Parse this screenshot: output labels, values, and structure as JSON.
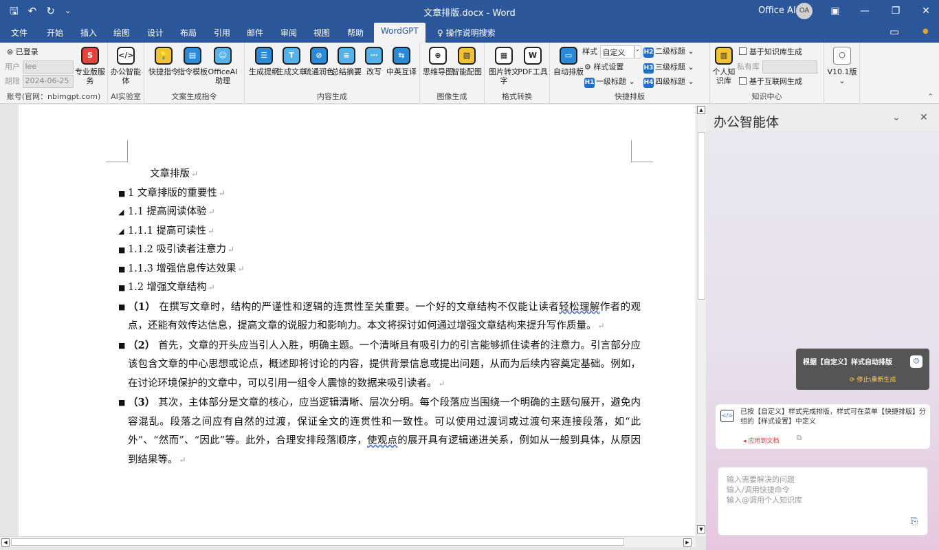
{
  "titlebar": {
    "qat": {
      "save_icon": "save-icon",
      "undo_icon": "undo-icon",
      "redo_icon": "redo-icon",
      "customize": "customize-icon"
    },
    "title": "文章排版.docx  -  Word",
    "account": "Office AI",
    "avatar": "OA",
    "window_buttons": {
      "ribbon_display": "▣",
      "minimize": "—",
      "restore": "❐",
      "close": "✕"
    }
  },
  "menubar": {
    "tabs": [
      "文件",
      "开始",
      "插入",
      "绘图",
      "设计",
      "布局",
      "引用",
      "邮件",
      "审阅",
      "视图",
      "帮助",
      "WordGPT"
    ],
    "active_tab": "WordGPT",
    "search": "操作说明搜索",
    "comments_icon": "comment-icon"
  },
  "ribbon": {
    "account": {
      "logged_in": "已登录",
      "user_label": "用户",
      "user_value": "lee",
      "expire_label": "期限",
      "expire_value": "2024-06-25",
      "pro_label": "专业版服务",
      "group": "账号(官网：nbimgpt.com)"
    },
    "lab": {
      "agent": "办公智能体",
      "group": "AI实验室"
    },
    "copy": {
      "quick": "快捷指令",
      "template": "指令模板",
      "assistant": "OfficeAI助理",
      "group": "文案生成指令"
    },
    "content": {
      "outline": "生成提纲",
      "article": "生成文章",
      "polish": "疏通润色",
      "summary": "总结摘要",
      "rewrite": "改写",
      "translate": "中英互译",
      "group": "内容生成"
    },
    "image": {
      "mindmap": "思维导图",
      "smartimg": "智能配图",
      "group": "图像生成"
    },
    "format": {
      "img2text": "图片转文字",
      "pdf": "PDF工具",
      "group": "格式转换"
    },
    "layout": {
      "auto": "自动排版",
      "style_label": "样式",
      "style_value": "自定义",
      "style_settings": "样式设置",
      "h1": "一级标题",
      "h2": "二级标题",
      "h3": "三级标题",
      "h4": "四级标题",
      "group": "快捷排版"
    },
    "knowledge": {
      "personal": "个人知识库",
      "private_label": "私有库",
      "kb_gen": "基于知识库生成",
      "web_gen": "基于互联网生成",
      "group": "知识中心"
    },
    "version": {
      "label": "V10.1版"
    }
  },
  "document": {
    "title": "文章排版",
    "headings": [
      "1  文章排版的重要性",
      "1.1  提高阅读体验",
      "1.1.1  提高可读性",
      "1.1.2  吸引读者注意力",
      "1.1.3  增强信息传达效果",
      "1.2  增强文章结构"
    ],
    "p1_num": "（1）",
    "p1_a": "在撰写文章时，结构的严谨性和逻辑的连贯性至关重要。一个好的文章结构不仅能让读者",
    "p1_u": "轻松理解",
    "p1_b": "作者的观点，还能有效传达信息，提高文章的说服力和影响力。本文将探讨如何通过增强文章结构来提升写作质量。",
    "p2_num": "（2）",
    "p2": "首先，文章的开头应当引人入胜，明确主题。一个清晰且有吸引力的引言能够抓住读者的注意力。引言部分应该包含文章的中心思想或论点，概述即将讨论的内容，提供背景信息或提出问题，从而为后续内容奠定基础。例如，在讨论环境保护的文章中，可以引用一组令人震惊的数据来吸引读者。",
    "p3_num": "（3）",
    "p3_a": "其次，主体部分是文章的核心，应当逻辑清晰、层次分明。每个段落应当围绕一个明确的主题句展开，避免内容混乱。段落之间应有自然的过渡，保证全文的连贯性和一致性。可以使用过渡词或过渡句来连接段落，如“此外”、“然而”、“因此”等。此外，合理安排段落顺序，",
    "p3_u": "使观点",
    "p3_b": "的展开具有逻辑递进关系，例如从一般到具体，从原因到结果等。"
  },
  "pane": {
    "title": "办公智能体",
    "notice_title": "根据【自定义】样式自动排版",
    "notice_stop": "停止\\重新生成",
    "msg_text": "已按【自定义】样式完成排版，样式可在菜单【快捷排版】分组的【样式设置】中定义",
    "msg_apply": "应用到文档",
    "input_placeholder": "输入需要解决的问题\n输入/调用快捷命令\n输入@调用个人知识库"
  }
}
